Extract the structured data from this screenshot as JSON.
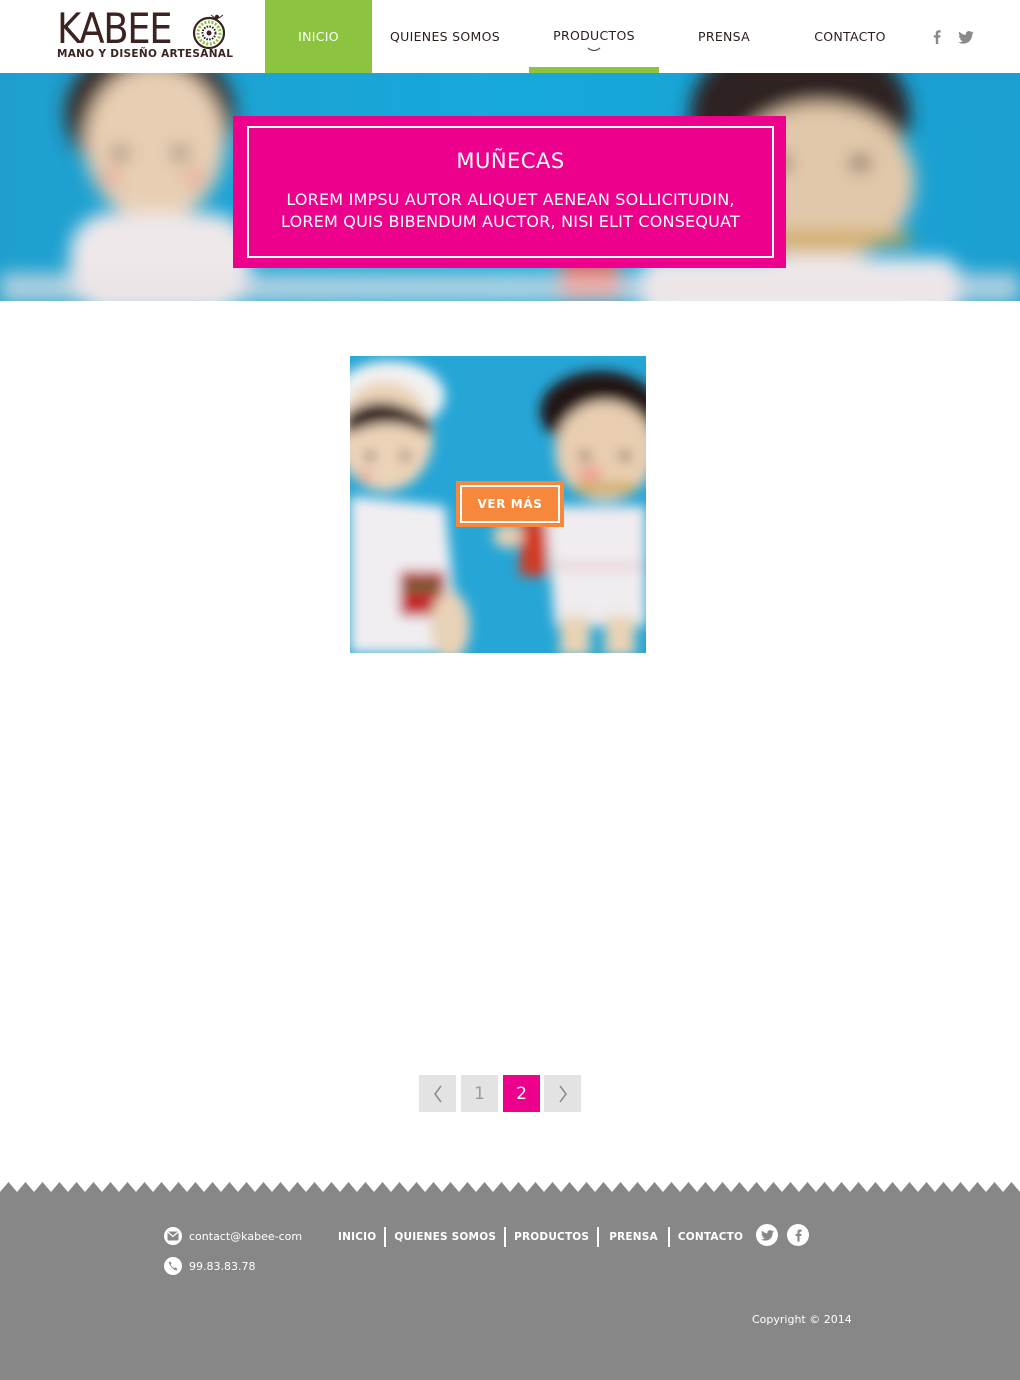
{
  "brand": {
    "name": "KABEE",
    "tagline": "MANO Y DISEÑO ARTESANAL"
  },
  "nav": {
    "items": [
      {
        "label": "INICIO",
        "active": true
      },
      {
        "label": "QUIENES SOMOS",
        "active": false
      },
      {
        "label": "PRODUCTOS",
        "active": false,
        "has_dropdown": true
      },
      {
        "label": "PRENSA",
        "active": false
      },
      {
        "label": "CONTACTO",
        "active": false
      }
    ],
    "social": [
      "facebook-icon",
      "twitter-icon"
    ]
  },
  "hero": {
    "title": "MUÑECAS",
    "subtitle_line1": "LOREM IMPSU AUTOR ALIQUET AENEAN SOLLICITUDIN,",
    "subtitle_line2": "LOREM QUIS BIBENDUM AUCTOR, NISI ELIT CONSEQUAT"
  },
  "product_card": {
    "button_label": "VER MÁS"
  },
  "pagination": {
    "pages": [
      "1",
      "2"
    ],
    "current": "2",
    "prev_icon": "chevron-left-icon",
    "next_icon": "chevron-right-icon"
  },
  "footer": {
    "email": "contact@kabee-com",
    "phone": "99.83.83.78",
    "nav": [
      "INICIO",
      "QUIENES SOMOS",
      "PRODUCTOS",
      "PRENSA",
      "CONTACTO"
    ],
    "social": [
      "twitter-icon",
      "facebook-icon"
    ],
    "copyright": "Copyright © 2014"
  },
  "colors": {
    "accent_green": "#8cc43f",
    "accent_pink": "#ec008c",
    "accent_orange": "#f7883b",
    "footer_gray": "#878787",
    "brand_brown": "#3b2420"
  }
}
